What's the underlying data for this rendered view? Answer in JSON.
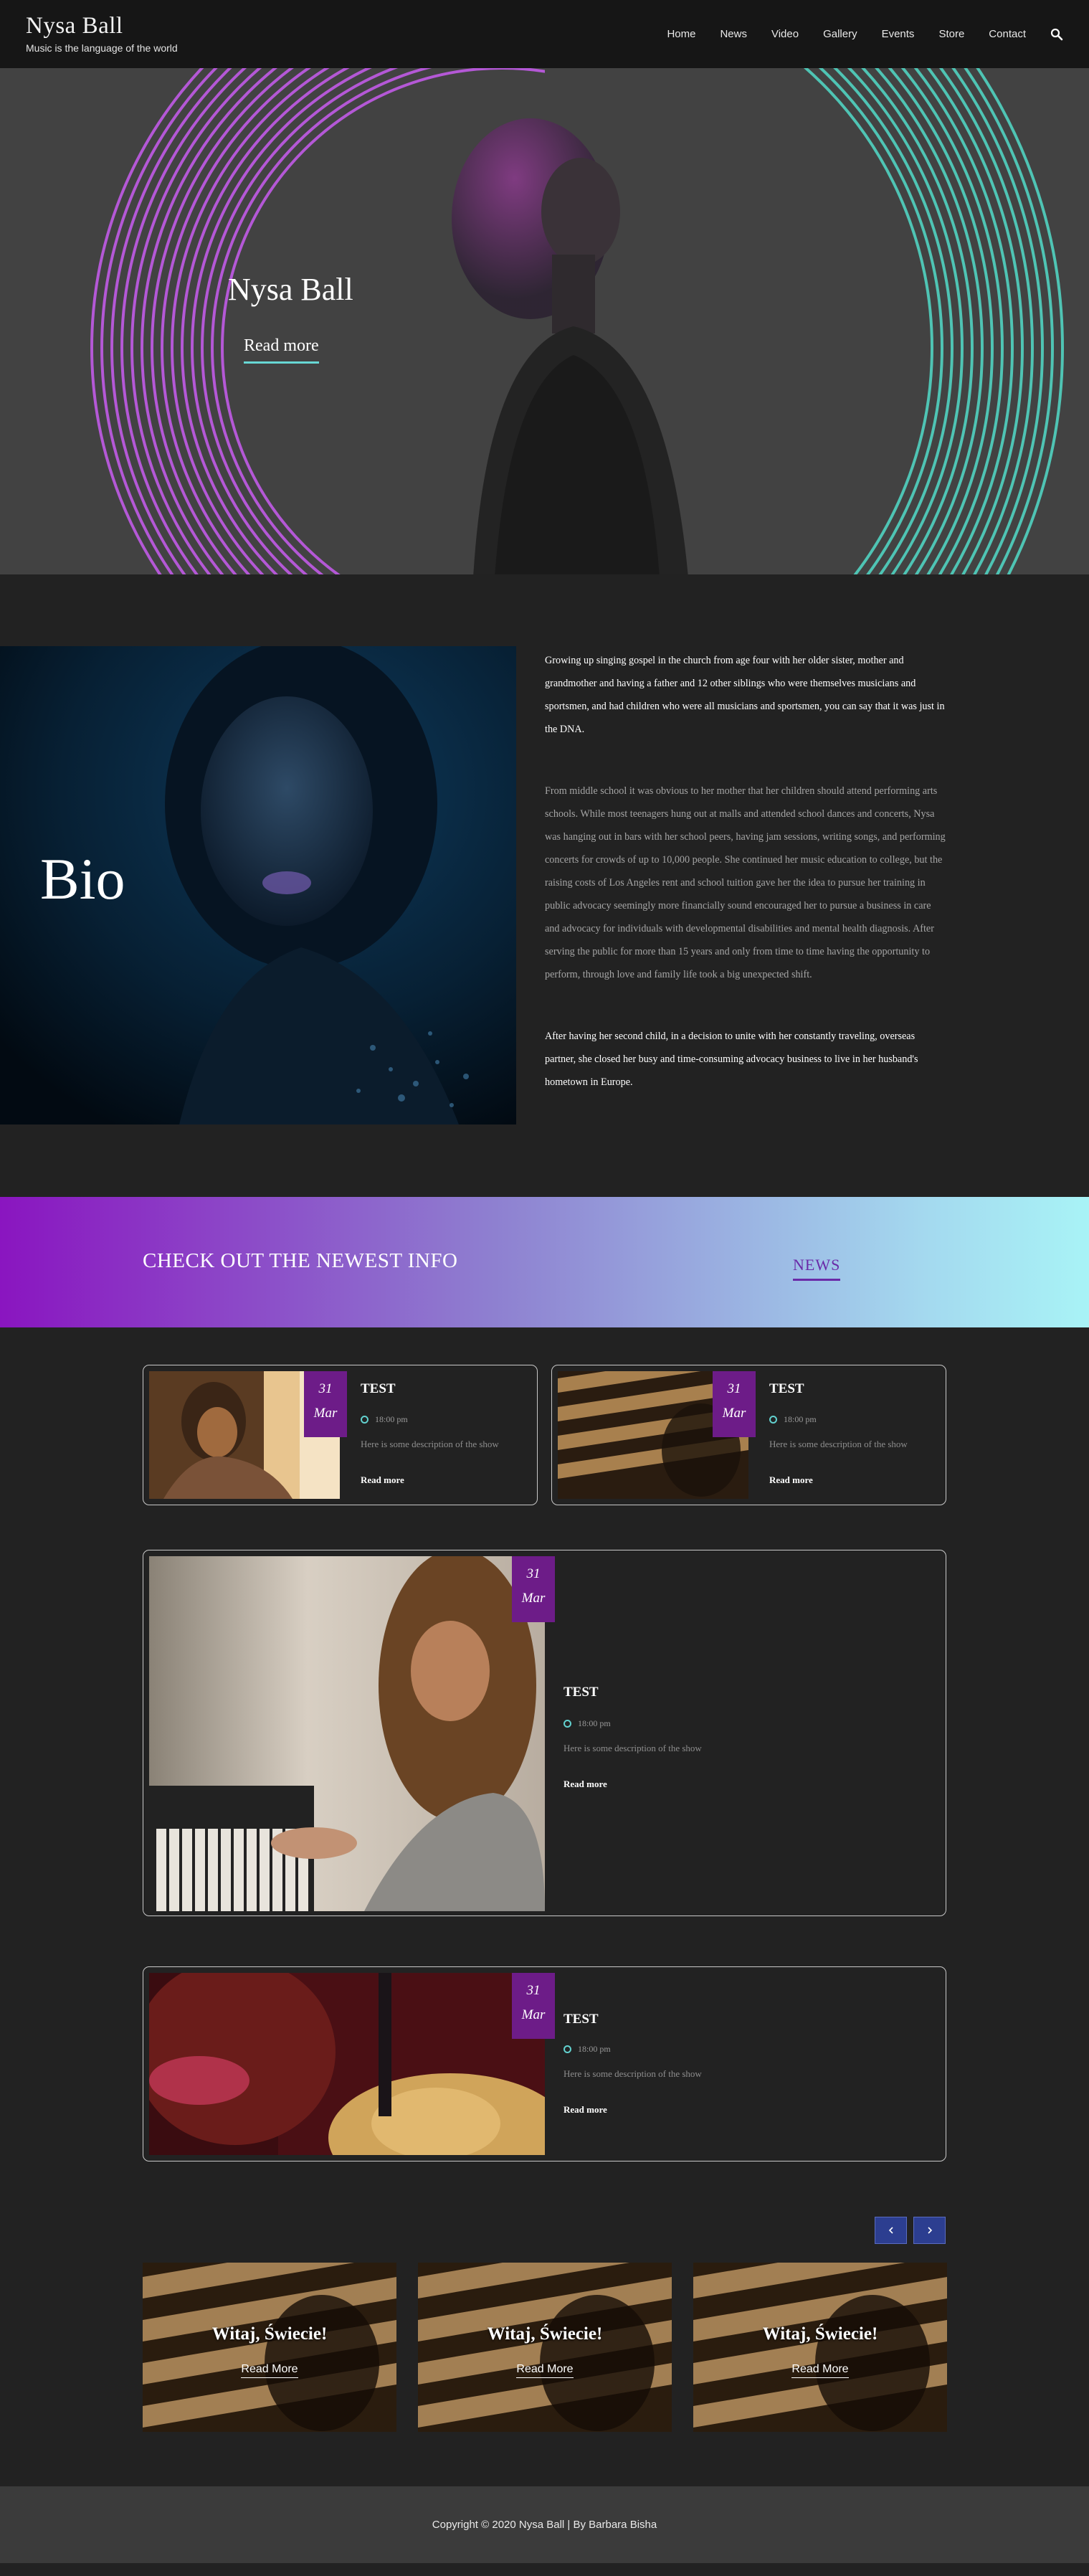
{
  "site": {
    "title": "Nysa Ball",
    "tagline": "Music is the language of the world"
  },
  "nav": {
    "items": [
      "Home",
      "News",
      "Video",
      "Gallery",
      "Events",
      "Store",
      "Contact"
    ],
    "search_icon": "search-icon"
  },
  "hero": {
    "title": "Nysa Ball",
    "button": "Read more",
    "accent": "#67d7d4",
    "ring_left_color": "#b458d6",
    "ring_right_color": "#4fc4b4"
  },
  "bio": {
    "title": "Bio",
    "paragraphs": [
      "Growing up singing gospel in the church from age four with her older sister, mother and grandmother and having a father and 12 other siblings who were themselves musicians and sportsmen, and had children who were all musicians and sportsmen, you can say that it was just in the DNA.",
      "From middle school it was obvious to her mother that her children should attend performing arts schools. While most teenagers hung out at malls and attended school dances and concerts, Nysa was hanging out in bars with her school peers, having jam sessions, writing songs, and performing concerts for crowds of up to 10,000 people. She continued her music education to college, but the raising costs of Los Angeles rent and school tuition gave her the idea to pursue her training in public advocacy seemingly more financially sound encouraged her to pursue a business in care and advocacy for individuals with developmental disabilities and mental health diagnosis. After serving the public for more than 15 years and only from time to time having the opportunity to perform, through love and family life took a big unexpected shift.",
      "After having her second child, in a decision to unite with her constantly traveling, overseas partner, she closed her busy and time-consuming advocacy business to live in her husband's hometown in Europe."
    ]
  },
  "news_banner": {
    "headline": "CHECK OUT THE NEWEST INFO",
    "link": "NEWS"
  },
  "events": [
    {
      "day": "31",
      "month": "Mar",
      "title": "TEST",
      "time": "18:00 pm",
      "description": "Here is some description of the show",
      "link": "Read more"
    },
    {
      "day": "31",
      "month": "Mar",
      "title": "TEST",
      "time": "18:00 pm",
      "description": "Here is some description of the show",
      "link": "Read more"
    },
    {
      "day": "31",
      "month": "Mar",
      "title": "TEST",
      "time": "18:00 pm",
      "description": "Here is some description of the show",
      "link": "Read more"
    },
    {
      "day": "31",
      "month": "Mar",
      "title": "TEST",
      "time": "18:00 pm",
      "description": "Here is some description of the show",
      "link": "Read more"
    }
  ],
  "carousel": {
    "prev_icon": "chevron-left-icon",
    "next_icon": "chevron-right-icon",
    "slides": [
      {
        "title": "Witaj, Świecie!",
        "button": "Read More"
      },
      {
        "title": "Witaj, Świecie!",
        "button": "Read More"
      },
      {
        "title": "Witaj, Świecie!",
        "button": "Read More"
      }
    ]
  },
  "footer": {
    "text": "Copyright © 2020 Nysa Ball | By Barbara Bisha"
  }
}
